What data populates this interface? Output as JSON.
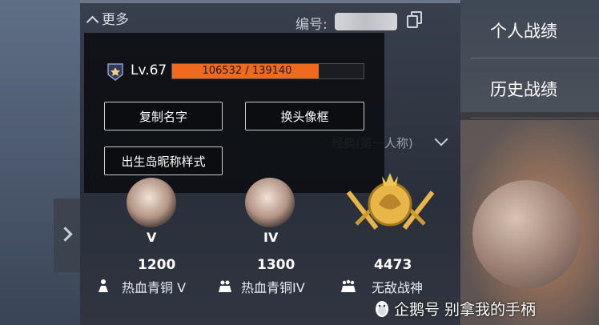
{
  "header": {
    "more_label": "更多",
    "id_label": "编号:"
  },
  "right_menu": {
    "items": [
      "个人战绩",
      "历史战绩"
    ]
  },
  "profile": {
    "level": "Lv.67",
    "xp_text": "106532 / 139140",
    "xp_fraction": 0.766
  },
  "actions": {
    "copy_name": "复制名字",
    "change_frame": "换头像框",
    "nickname_style": "出生岛昵称样式"
  },
  "mode_select": {
    "label": "经典(第一人称)"
  },
  "ranks": [
    {
      "tier": "V",
      "score": "1200",
      "name": "热血青铜 V"
    },
    {
      "tier": "IV",
      "score": "1300",
      "name": "热血青铜IV"
    },
    {
      "tier": "",
      "score": "4473",
      "name": "无敌战神"
    }
  ],
  "watermark": {
    "text": "企鹅号 别拿我的手柄"
  },
  "colors": {
    "xp_fill": "#ee6a1f",
    "gold": "#e7b646"
  }
}
